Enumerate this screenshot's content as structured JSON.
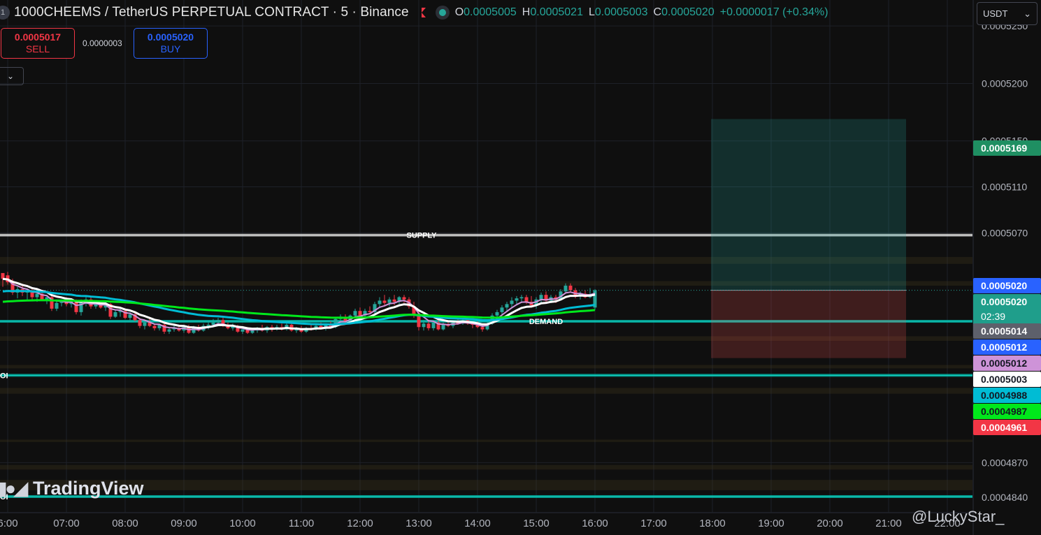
{
  "header": {
    "badge": "1",
    "title": "1000CHEEMS / TetherUS PERPETUAL CONTRACT · 5 · Binance",
    "ohlc": [
      {
        "k": "O",
        "v": "0.0005005"
      },
      {
        "k": "H",
        "v": "0.0005021"
      },
      {
        "k": "L",
        "v": "0.0005003"
      },
      {
        "k": "C",
        "v": "0.0005020"
      }
    ],
    "change": "+0.0000017 (+0.34%)"
  },
  "trade": {
    "sell_price": "0.0005017",
    "sell_label": "SELL",
    "spread": "0.0000003",
    "buy_price": "0.0005020",
    "buy_label": "BUY"
  },
  "collapse_icon": "chevron-down-icon",
  "currency_select": {
    "value": "USDT"
  },
  "watermark": {
    "brand": "TradingView",
    "logo_icon": "tradingview-logo-icon",
    "credit": "@LuckyStar_"
  },
  "colors": {
    "background": "#0f0f0f",
    "bull": "#26a69a",
    "bear": "#f23645",
    "ma_fast": "#ce93d8",
    "ma_mid": "#ffffff",
    "ma_slow": "#00bcd4",
    "ma_long": "#00e81b",
    "zone_supply": "#4a4020",
    "zone_demand": "#00897b",
    "target_box": "#26a69a",
    "stop_box": "#ef5350"
  },
  "chart_data": {
    "type": "candlestick",
    "ylim": [
      0.00048265,
      0.00052726
    ],
    "x_ticks": [
      "6:00",
      "07:00",
      "08:00",
      "09:00",
      "10:00",
      "11:00",
      "12:00",
      "13:00",
      "14:00",
      "15:00",
      "16:00",
      "17:00",
      "18:00",
      "19:00",
      "20:00",
      "21:00",
      "22:00"
    ],
    "y_ticks": [
      0.000525,
      0.00052,
      0.000515,
      0.000511,
      0.000507,
      0.000487,
      0.000484
    ],
    "annotations": [
      {
        "type": "zone",
        "label": "SUPPLY",
        "from": 0.0005067,
        "to": 0.0005069
      },
      {
        "type": "zone",
        "label": "DEMAND",
        "from": 0.0004992,
        "to": 0.0004994
      },
      {
        "type": "zone",
        "label": "OI",
        "from": 0.0004945,
        "to": 0.0004947
      },
      {
        "type": "zone",
        "label": "OI",
        "from": 0.0004839,
        "to": 0.0004842
      }
    ],
    "price_labels": [
      {
        "value": "0.0005169",
        "color": "#1f8f62",
        "text_color": "#ffffff"
      },
      {
        "value": "0.0005020",
        "color": "#2962ff",
        "text_color": "#ffffff"
      },
      {
        "value": "0.0005020",
        "sub": "02:39",
        "color": "#1f9e8b",
        "text_color": "#ffffff"
      },
      {
        "value": "0.0005014",
        "color": "#5d606b",
        "text_color": "#ffffff"
      },
      {
        "value": "0.0005012",
        "color": "#2962ff",
        "text_color": "#ffffff"
      },
      {
        "value": "0.0005012",
        "color": "#ce93d8",
        "text_color": "#131722"
      },
      {
        "value": "0.0005003",
        "color": "#ffffff",
        "text_color": "#131722"
      },
      {
        "value": "0.0004988",
        "color": "#00bcd4",
        "text_color": "#131722"
      },
      {
        "value": "0.0004987",
        "color": "#00e81b",
        "text_color": "#131722"
      },
      {
        "value": "0.0004961",
        "color": "#f23645",
        "text_color": "#ffffff"
      }
    ],
    "position": {
      "entry": 0.000502,
      "target": 0.0005169,
      "stop": 0.0004961
    },
    "series": [
      {
        "type": "candles",
        "x_start": "05:55",
        "interval_min": 5,
        "ohlc": [
          [
            0.0005035,
            0.0005035,
            0.0005023,
            0.000503
          ],
          [
            0.0005033,
            0.0005036,
            0.0005025,
            0.0005027
          ],
          [
            0.0005027,
            0.000503,
            0.0005016,
            0.0005018
          ],
          [
            0.0005018,
            0.0005023,
            0.0005013,
            0.0005021
          ],
          [
            0.0005021,
            0.0005024,
            0.0005015,
            0.0005018
          ],
          [
            0.0005018,
            0.0005021,
            0.0005012,
            0.0005019
          ],
          [
            0.0005019,
            0.0005022,
            0.0005011,
            0.0005014
          ],
          [
            0.0005014,
            0.0005019,
            0.000501,
            0.0005017
          ],
          [
            0.0005017,
            0.000502,
            0.0005011,
            0.0005012
          ],
          [
            0.0005012,
            0.0005016,
            0.0005008,
            0.0005014
          ],
          [
            0.0005014,
            0.0005016,
            0.0005002,
            0.0005004
          ],
          [
            0.0005004,
            0.0005012,
            0.0005002,
            0.0005009
          ],
          [
            0.0005009,
            0.0005012,
            0.0005006,
            0.000501
          ],
          [
            0.000501,
            0.0005014,
            0.0005006,
            0.0005008
          ],
          [
            0.0005008,
            0.0005012,
            0.0005005,
            0.000501
          ],
          [
            0.000501,
            0.0005012,
            0.0004999,
            0.0005001
          ],
          [
            0.0005001,
            0.0005012,
            0.0004998,
            0.0005009
          ],
          [
            0.0005009,
            0.0005014,
            0.0005006,
            0.0005012
          ],
          [
            0.0005012,
            0.0005014,
            0.0005004,
            0.0005006
          ],
          [
            0.0005006,
            0.0005011,
            0.0005004,
            0.0005009
          ],
          [
            0.0005009,
            0.0005011,
            0.0005004,
            0.0005005
          ],
          [
            0.0005005,
            0.0005009,
            0.0005002,
            0.0005008
          ],
          [
            0.0005008,
            0.0005009,
            0.0004995,
            0.0004997
          ],
          [
            0.0004997,
            0.0005003,
            0.0004996,
            0.0005001
          ],
          [
            0.0005001,
            0.0005004,
            0.0004997,
            0.0005002
          ],
          [
            0.0005002,
            0.0005004,
            0.0004995,
            0.0004996
          ],
          [
            0.0004996,
            0.0005001,
            0.0004994,
            0.0004999
          ],
          [
            0.0004999,
            0.0005,
            0.0004993,
            0.0004994
          ],
          [
            0.0004994,
            0.0004996,
            0.0004987,
            0.0004989
          ],
          [
            0.0004989,
            0.0004994,
            0.0004986,
            0.0004992
          ],
          [
            0.0004992,
            0.0004996,
            0.0004988,
            0.0004989
          ],
          [
            0.0004989,
            0.0004991,
            0.0004985,
            0.0004987
          ],
          [
            0.0004987,
            0.0004991,
            0.0004985,
            0.000499
          ],
          [
            0.000499,
            0.0004992,
            0.0004982,
            0.0004984
          ],
          [
            0.0004984,
            0.0004988,
            0.0004982,
            0.0004986
          ],
          [
            0.0004986,
            0.000499,
            0.0004984,
            0.0004987
          ],
          [
            0.0004987,
            0.0004989,
            0.0004984,
            0.0004985
          ],
          [
            0.0004985,
            0.000499,
            0.0004983,
            0.0004988
          ],
          [
            0.0004988,
            0.000499,
            0.0004982,
            0.0004983
          ],
          [
            0.0004983,
            0.0004989,
            0.0004982,
            0.0004987
          ],
          [
            0.0004987,
            0.000499,
            0.0004984,
            0.0004985
          ],
          [
            0.0004985,
            0.0004991,
            0.0004984,
            0.0004989
          ],
          [
            0.0004989,
            0.0004992,
            0.0004986,
            0.000499
          ],
          [
            0.000499,
            0.0004995,
            0.0004988,
            0.0004992
          ],
          [
            0.0004992,
            0.0004996,
            0.000499,
            0.0004994
          ],
          [
            0.0004994,
            0.0004996,
            0.0004988,
            0.000499
          ],
          [
            0.000499,
            0.0004992,
            0.0004986,
            0.0004987
          ],
          [
            0.0004987,
            0.0004991,
            0.0004985,
            0.0004989
          ],
          [
            0.0004989,
            0.000499,
            0.0004983,
            0.0004984
          ],
          [
            0.0004984,
            0.0004988,
            0.0004982,
            0.0004986
          ],
          [
            0.0004986,
            0.0004988,
            0.0004982,
            0.0004983
          ],
          [
            0.0004983,
            0.0004987,
            0.0004982,
            0.0004985
          ],
          [
            0.0004985,
            0.0004988,
            0.0004983,
            0.0004987
          ],
          [
            0.0004987,
            0.000499,
            0.0004984,
            0.0004985
          ],
          [
            0.0004985,
            0.0004989,
            0.0004983,
            0.0004988
          ],
          [
            0.0004988,
            0.000499,
            0.0004984,
            0.0004986
          ],
          [
            0.0004986,
            0.000499,
            0.0004985,
            0.0004988
          ],
          [
            0.0004988,
            0.0004991,
            0.0004985,
            0.0004986
          ],
          [
            0.0004986,
            0.0004992,
            0.0004985,
            0.000499
          ],
          [
            0.000499,
            0.0004992,
            0.0004984,
            0.0004985
          ],
          [
            0.0004985,
            0.0004988,
            0.0004983,
            0.0004986
          ],
          [
            0.0004986,
            0.0004989,
            0.0004983,
            0.0004984
          ],
          [
            0.0004984,
            0.0004988,
            0.0004983,
            0.0004987
          ],
          [
            0.0004987,
            0.000499,
            0.0004985,
            0.0004986
          ],
          [
            0.0004986,
            0.000499,
            0.0004985,
            0.0004989
          ],
          [
            0.0004989,
            0.0004992,
            0.0004986,
            0.0004987
          ],
          [
            0.0004987,
            0.0004991,
            0.0004985,
            0.000499
          ],
          [
            0.000499,
            0.0004993,
            0.0004987,
            0.0004988
          ],
          [
            0.0004988,
            0.0004996,
            0.0004987,
            0.0004995
          ],
          [
            0.0004995,
            0.0004999,
            0.0004992,
            0.0004997
          ],
          [
            0.0004997,
            0.0004999,
            0.0004991,
            0.0004993
          ],
          [
            0.0004993,
            0.0004999,
            0.0004992,
            0.0004998
          ],
          [
            0.0004998,
            0.0005004,
            0.0004996,
            0.0005002
          ],
          [
            0.0005002,
            0.0005005,
            0.0004996,
            0.0004998
          ],
          [
            0.0004998,
            0.0005004,
            0.0004997,
            0.0005002
          ],
          [
            0.0005002,
            0.0005006,
            0.0004999,
            0.0005001
          ],
          [
            0.0005001,
            0.000501,
            0.0004999,
            0.0005008
          ],
          [
            0.0005008,
            0.0005014,
            0.0005005,
            0.0005011
          ],
          [
            0.0005011,
            0.0005016,
            0.0005006,
            0.0005009
          ],
          [
            0.0005009,
            0.0005014,
            0.0005006,
            0.0005012
          ],
          [
            0.0005012,
            0.0005016,
            0.0005007,
            0.000501
          ],
          [
            0.000501,
            0.0005015,
            0.0005008,
            0.0005014
          ],
          [
            0.0005014,
            0.0005016,
            0.0005009,
            0.0005012
          ],
          [
            0.0005012,
            0.0005014,
            0.0005004,
            0.0005006
          ],
          [
            0.0005006,
            0.000501,
            0.0004996,
            0.0004998
          ],
          [
            0.0004998,
            0.0005002,
            0.0004985,
            0.0004988
          ],
          [
            0.0004988,
            0.0004994,
            0.0004985,
            0.0004991
          ],
          [
            0.0004991,
            0.0004994,
            0.0004985,
            0.0004987
          ],
          [
            0.0004987,
            0.0004993,
            0.0004985,
            0.0004992
          ],
          [
            0.0004992,
            0.0004994,
            0.0004985,
            0.0004986
          ],
          [
            0.0004986,
            0.0004992,
            0.0004985,
            0.000499
          ],
          [
            0.000499,
            0.0004993,
            0.0004988,
            0.0004989
          ],
          [
            0.0004989,
            0.0004993,
            0.0004987,
            0.0004992
          ],
          [
            0.0004992,
            0.0004995,
            0.000499,
            0.0004991
          ],
          [
            0.0004991,
            0.0004996,
            0.000499,
            0.0004994
          ],
          [
            0.0004994,
            0.0004996,
            0.000499,
            0.0004991
          ],
          [
            0.0004991,
            0.0004993,
            0.0004987,
            0.000499
          ],
          [
            0.000499,
            0.0004993,
            0.0004987,
            0.0004988
          ],
          [
            0.0004988,
            0.000499,
            0.0004984,
            0.0004986
          ],
          [
            0.0004986,
            0.0004992,
            0.0004985,
            0.0004991
          ],
          [
            0.0004991,
            0.0005,
            0.000499,
            0.0004998
          ],
          [
            0.0004998,
            0.0005003,
            0.0004995,
            0.0005001
          ],
          [
            0.0005001,
            0.0005007,
            0.0004999,
            0.0005005
          ],
          [
            0.0005005,
            0.000501,
            0.0005002,
            0.0005008
          ],
          [
            0.0005008,
            0.0005014,
            0.0005005,
            0.0005011
          ],
          [
            0.0005011,
            0.0005015,
            0.0005007,
            0.0005013
          ],
          [
            0.0005013,
            0.0005016,
            0.0005009,
            0.0005014
          ],
          [
            0.0005014,
            0.0005016,
            0.0005008,
            0.000501
          ],
          [
            0.000501,
            0.0005015,
            0.0005005,
            0.0005007
          ],
          [
            0.0005007,
            0.0005014,
            0.0005004,
            0.0005012
          ],
          [
            0.0005012,
            0.0005018,
            0.0005009,
            0.0005016
          ],
          [
            0.0005016,
            0.0005019,
            0.000501,
            0.0005011
          ],
          [
            0.0005011,
            0.0005016,
            0.0005009,
            0.0005014
          ],
          [
            0.0005014,
            0.0005016,
            0.0005009,
            0.0005012
          ],
          [
            0.0005012,
            0.0005021,
            0.0005011,
            0.0005019
          ],
          [
            0.0005019,
            0.0005026,
            0.0005017,
            0.0005024
          ],
          [
            0.0005024,
            0.0005026,
            0.0005018,
            0.000502
          ],
          [
            0.000502,
            0.0005022,
            0.0005013,
            0.0005015
          ],
          [
            0.0005015,
            0.0005019,
            0.0005012,
            0.0005017
          ],
          [
            0.0005017,
            0.000502,
            0.0005013,
            0.0005014
          ],
          [
            0.0005014,
            0.0005022,
            0.0005013,
            0.0005016
          ],
          [
            0.0005005,
            0.0005021,
            0.0005003,
            0.000502
          ]
        ]
      },
      {
        "name": "MA fast",
        "type": "line",
        "color": "#ce93d8"
      },
      {
        "name": "MA mid",
        "type": "line",
        "color": "#ffffff"
      },
      {
        "name": "MA slow",
        "type": "line",
        "color": "#00bcd4"
      },
      {
        "name": "MA long",
        "type": "line",
        "color": "#00e81b"
      }
    ]
  }
}
